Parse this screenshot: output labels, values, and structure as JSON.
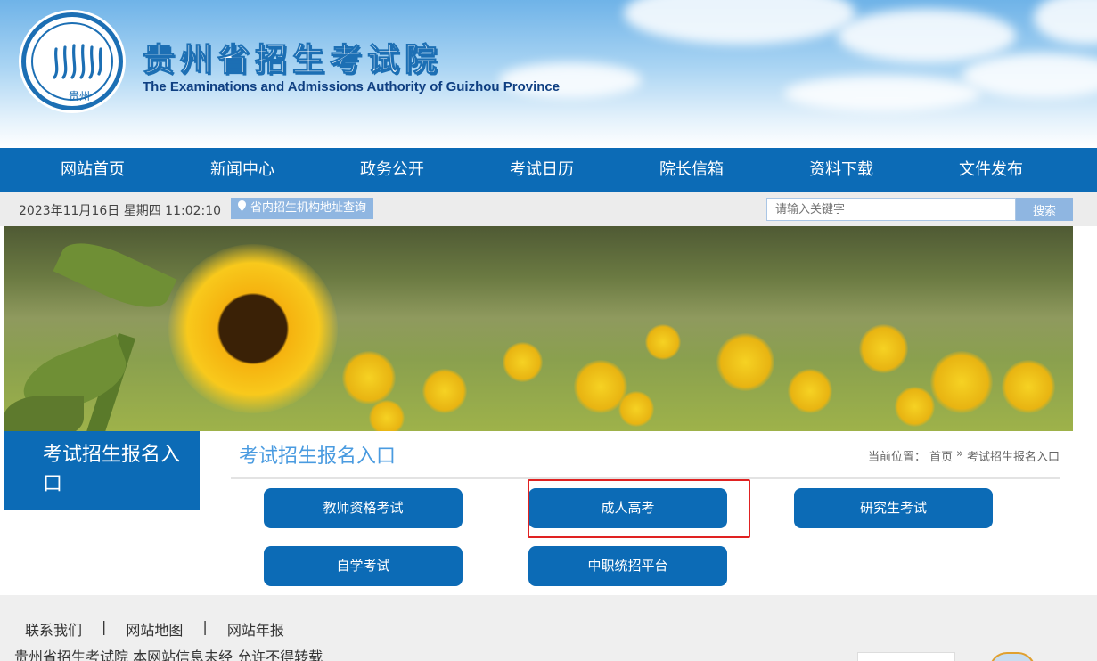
{
  "header": {
    "logo_text": "贵州",
    "title": "贵州省招生考试院",
    "subtitle": "The Examinations and Admissions Authority of Guizhou Province"
  },
  "nav": {
    "items": [
      {
        "label": "网站首页"
      },
      {
        "label": "新闻中心"
      },
      {
        "label": "政务公开"
      },
      {
        "label": "考试日历"
      },
      {
        "label": "院长信箱"
      },
      {
        "label": "资料下载"
      },
      {
        "label": "文件发布"
      }
    ]
  },
  "infobar": {
    "datetime": "2023年11月16日 星期四 11:02:10",
    "address_link": "省内招生机构地址查询",
    "search_placeholder": "请输入关键字",
    "search_button": "搜索"
  },
  "sidebar": {
    "title": "考试招生报名入口"
  },
  "main": {
    "title": "考试招生报名入口",
    "breadcrumb": {
      "prefix": "当前位置：",
      "home": "首页",
      "separator": "»",
      "current": "考试招生报名入口"
    },
    "entries": [
      {
        "label": "教师资格考试"
      },
      {
        "label": "成人高考",
        "highlighted": true
      },
      {
        "label": "研究生考试"
      },
      {
        "label": "自学考试"
      },
      {
        "label": "中职统招平台"
      }
    ],
    "highlight_color": "#e02222"
  },
  "footer": {
    "links": [
      "联系我们",
      "网站地图",
      "网站年报"
    ],
    "link_separator": "|",
    "copyright": "贵州省招生考试院    本网站信息未经 允许不得转载"
  },
  "colors": {
    "primary": "#0c6bb6",
    "accent_light": "#8fb6e1",
    "title_blue": "#4a9be0"
  }
}
